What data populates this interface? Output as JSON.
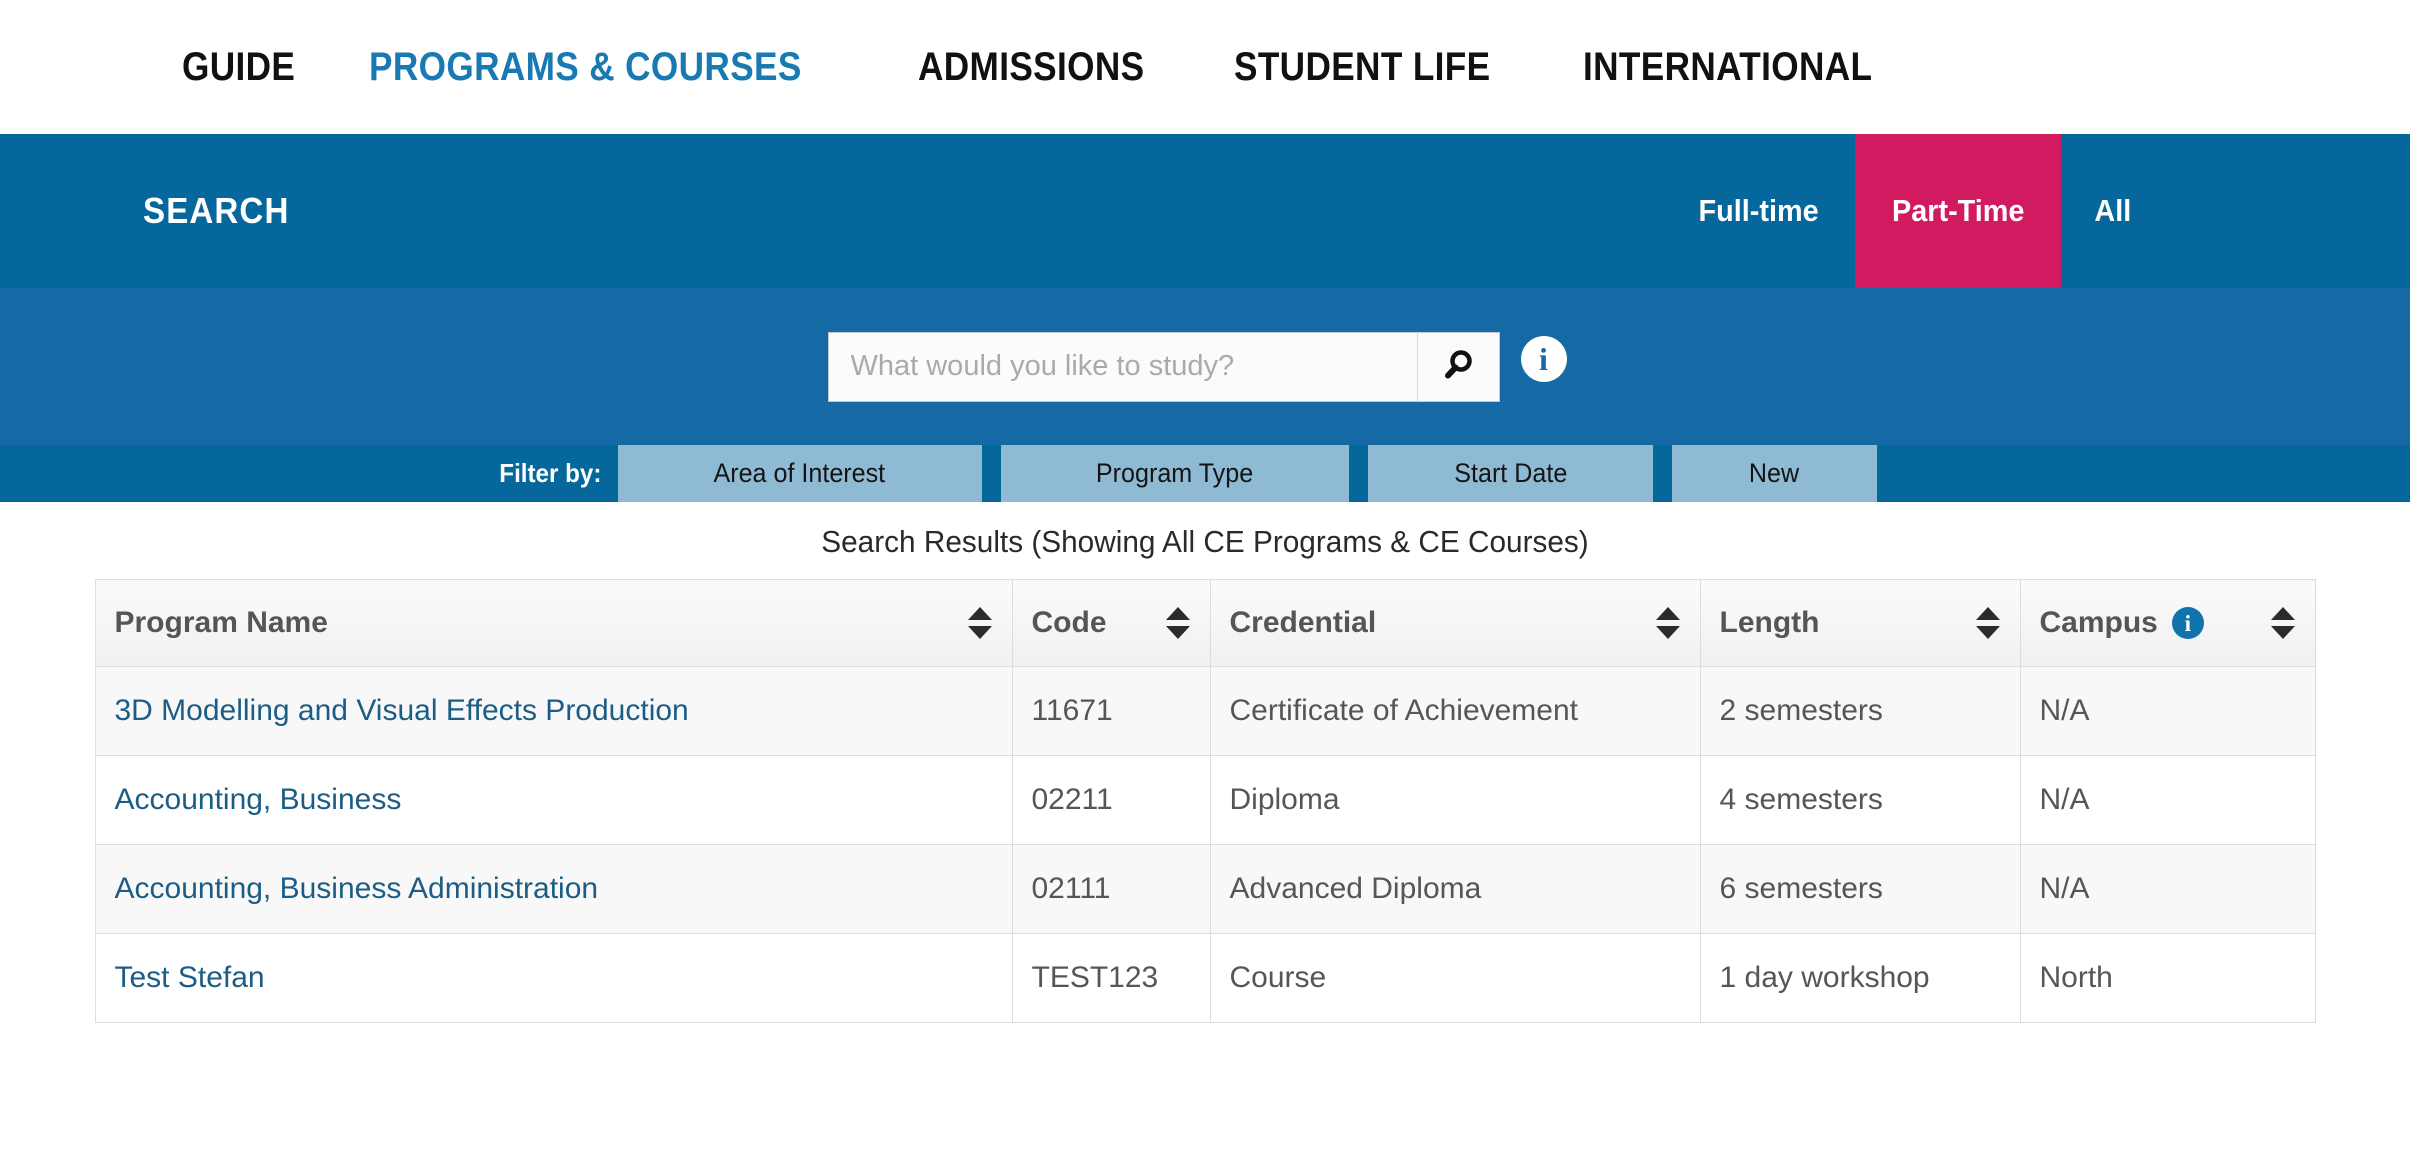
{
  "topnav": {
    "items": [
      {
        "label": "GUIDE",
        "active": false
      },
      {
        "label": "PROGRAMS & COURSES",
        "active": true
      },
      {
        "label": "ADMISSIONS",
        "active": false
      },
      {
        "label": "STUDENT LIFE",
        "active": false
      },
      {
        "label": "INTERNATIONAL",
        "active": false
      }
    ]
  },
  "searchbar": {
    "label": "SEARCH",
    "tabs": [
      {
        "label": "Full-time",
        "selected": false
      },
      {
        "label": "Part-Time",
        "selected": true
      },
      {
        "label": "All",
        "selected": false
      }
    ]
  },
  "search": {
    "value": "",
    "placeholder": "What would you like to study?",
    "button_icon": "search-icon",
    "info_icon": "info-icon",
    "info_label": "i"
  },
  "filters": {
    "label": "Filter by:",
    "buttons": [
      {
        "label": "Area of Interest"
      },
      {
        "label": "Program Type"
      },
      {
        "label": "Start Date"
      },
      {
        "label": "New"
      }
    ]
  },
  "results": {
    "title": "Search Results (Showing All CE Programs & CE Courses)",
    "columns": [
      {
        "label": "Program Name",
        "sortable": true,
        "info": false
      },
      {
        "label": "Code",
        "sortable": true,
        "info": false
      },
      {
        "label": "Credential",
        "sortable": true,
        "info": false
      },
      {
        "label": "Length",
        "sortable": true,
        "info": false
      },
      {
        "label": "Campus",
        "sortable": true,
        "info": true,
        "info_label": "i"
      }
    ],
    "rows": [
      {
        "name": "3D Modelling and Visual Effects Production",
        "code": "11671",
        "credential": "Certificate of Achievement",
        "length": "2 semesters",
        "campus": "N/A"
      },
      {
        "name": "Accounting, Business",
        "code": "02211",
        "credential": "Diploma",
        "length": "4 semesters",
        "campus": "N/A"
      },
      {
        "name": "Accounting, Business Administration",
        "code": "02111",
        "credential": "Advanced Diploma",
        "length": "6 semesters",
        "campus": "N/A"
      },
      {
        "name": "Test Stefan",
        "code": "TEST123",
        "credential": "Course",
        "length": "1 day workshop",
        "campus": "North"
      }
    ]
  },
  "colors": {
    "nav_active": "#1879b3",
    "band_dark": "#06679c",
    "band_light": "#1569a4",
    "tab_selected": "#d21a60",
    "filter_button": "#8fbad4",
    "link": "#1c5d85"
  }
}
